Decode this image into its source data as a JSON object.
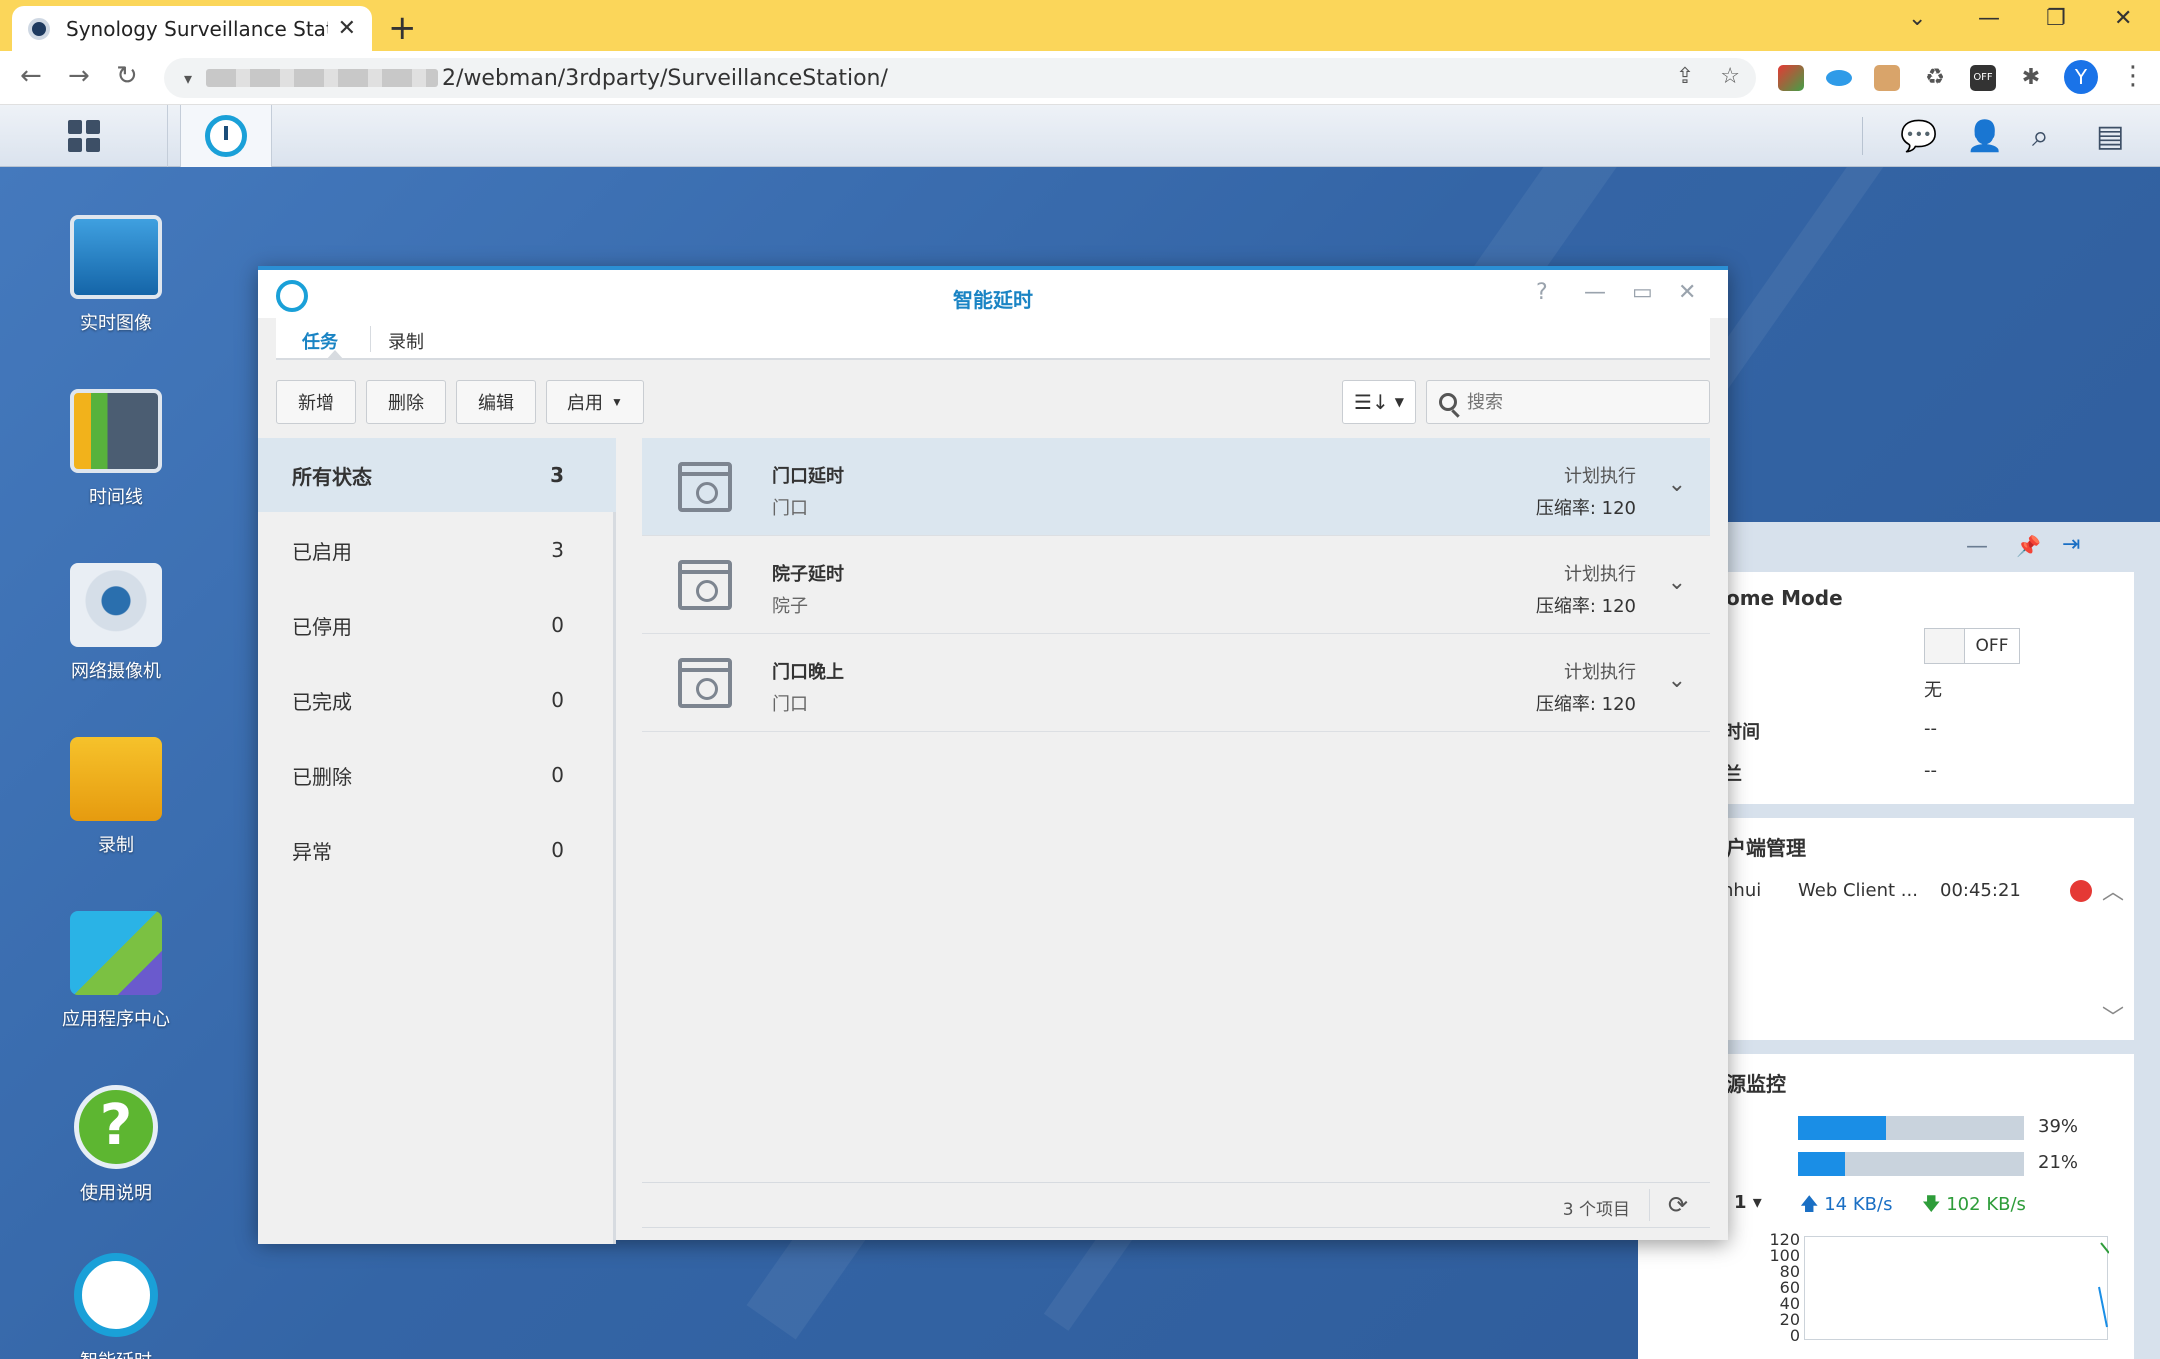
{
  "browser": {
    "tab_title": "Synology Surveillance Station",
    "url": "2/webman/3rdparty/SurveillanceStation/",
    "avatar_letter": "Y",
    "off_badge": "OFF"
  },
  "window": {
    "title": "智能延时",
    "tabs": [
      {
        "label": "任务"
      },
      {
        "label": "录制"
      }
    ],
    "toolbar": {
      "add": "新增",
      "delete": "删除",
      "edit": "编辑",
      "enable": "启用",
      "search_placeholder": "搜索"
    },
    "filters": [
      {
        "label": "所有状态",
        "count": "3"
      },
      {
        "label": "已启用",
        "count": "3"
      },
      {
        "label": "已停用",
        "count": "0"
      },
      {
        "label": "已完成",
        "count": "0"
      },
      {
        "label": "已删除",
        "count": "0"
      },
      {
        "label": "异常",
        "count": "0"
      }
    ],
    "tasks": [
      {
        "name": "门口延时",
        "camera": "门口",
        "mode": "计划执行",
        "rate": "压缩率: 120"
      },
      {
        "name": "院子延时",
        "camera": "院子",
        "mode": "计划执行",
        "rate": "压缩率: 120"
      },
      {
        "name": "门口晚上",
        "camera": "门口",
        "mode": "计划执行",
        "rate": "压缩率: 120"
      }
    ],
    "item_count": "3 个项目"
  },
  "desktop": {
    "icons": [
      {
        "label": "实时图像"
      },
      {
        "label": "时间线"
      },
      {
        "label": "网络摄像机"
      },
      {
        "label": "录制"
      },
      {
        "label": "应用程序中心"
      },
      {
        "label": "使用说明"
      },
      {
        "label": "智能延时"
      }
    ]
  },
  "widgets": {
    "home_mode": {
      "title": "ome Mode",
      "toggle": "OFF",
      "value1": "无",
      "label2": "时间",
      "value2": "--",
      "label3": "兰",
      "value3": "--"
    },
    "clients": {
      "title": "户端管理",
      "user": "nhui",
      "client": "Web Client ...",
      "time": "00:45:21"
    },
    "resource": {
      "title": "源监控",
      "cpu": "39%",
      "cpu_value": 0.39,
      "ram": "21%",
      "ram_value": 0.21,
      "net_select": "1",
      "upload": "14 KB/s",
      "download": "102 KB/s",
      "yticks": [
        "120",
        "100",
        "80",
        "60",
        "40",
        "20",
        "0"
      ]
    }
  },
  "colors": {
    "accent": "#1a84c4",
    "chrome_tab_bar": "#fbd65a",
    "desktop_bg": "#3a6aa8"
  }
}
